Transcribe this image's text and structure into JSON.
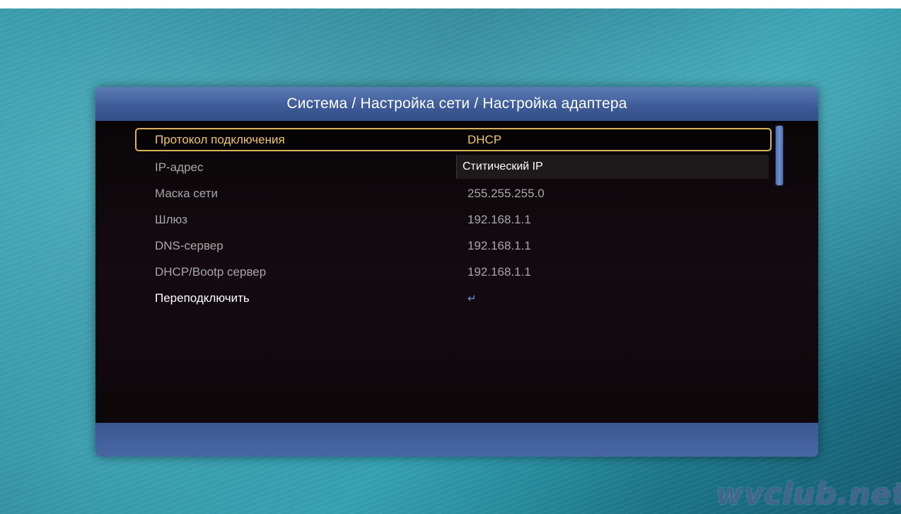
{
  "header": {
    "title": "Система / Настройка сети / Настройка адаптера"
  },
  "settings": {
    "rows": [
      {
        "label": "Протокол подключения",
        "value": "DHCP"
      },
      {
        "label": "IP-адрес",
        "value": ""
      },
      {
        "label": "Маска сети",
        "value": "255.255.255.0"
      },
      {
        "label": "Шлюз",
        "value": "192.168.1.1"
      },
      {
        "label": "DNS-сервер",
        "value": "192.168.1.1"
      },
      {
        "label": "DHCP/Bootp сервер",
        "value": "192.168.1.1"
      },
      {
        "label": "Переподключить",
        "value": "↵"
      }
    ]
  },
  "dropdown": {
    "option": "Ститический IP"
  },
  "icons": {
    "reconnect": "enter-return-icon"
  },
  "colors": {
    "accent": "#f2c66a",
    "header": "#3d5a96",
    "body": "#0a0608"
  },
  "watermark": "wvclub.net"
}
